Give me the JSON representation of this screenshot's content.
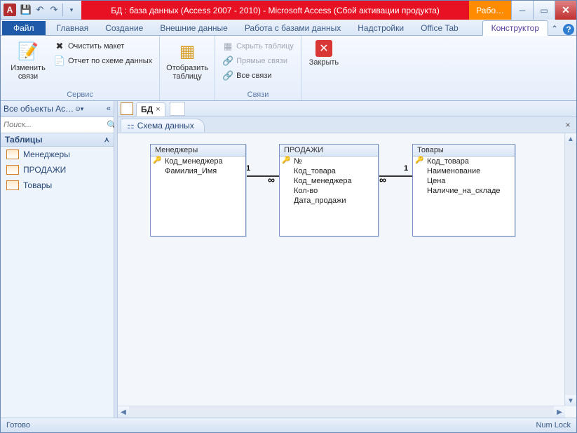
{
  "title": "БД : база данных (Access 2007 - 2010)  -  Microsoft Access (Сбой активации продукта)",
  "contextTab": "Рабо…",
  "tabs": {
    "file": "Файл",
    "items": [
      "Главная",
      "Создание",
      "Внешние данные",
      "Работа с базами данных",
      "Надстройки",
      "Office Tab"
    ],
    "active": "Конструктор"
  },
  "ribbon": {
    "g1": {
      "label": "Сервис",
      "edit": "Изменить\nсвязи",
      "clear": "Очистить макет",
      "report": "Отчет по схеме данных"
    },
    "g2": {
      "label": "",
      "show": "Отобразить\nтаблицу"
    },
    "g3": {
      "label": "Связи",
      "hide": "Скрыть таблицу",
      "direct": "Прямые связи",
      "all": "Все связи"
    },
    "g4": {
      "close": "Закрыть"
    }
  },
  "nav": {
    "header": "Все объекты Ac…",
    "searchPlaceholder": "Поиск...",
    "section": "Таблицы",
    "items": [
      "Менеджеры",
      "ПРОДАЖИ",
      "Товары"
    ]
  },
  "docTab": "БД",
  "schemaTab": "Схема данных",
  "tables": {
    "t1": {
      "title": "Менеджеры",
      "fields": [
        {
          "n": "Код_менеджера",
          "k": true
        },
        {
          "n": "Фамилия_Имя",
          "k": false
        }
      ]
    },
    "t2": {
      "title": "ПРОДАЖИ",
      "fields": [
        {
          "n": "№",
          "k": true
        },
        {
          "n": "Код_товара",
          "k": false
        },
        {
          "n": "Код_менеджера",
          "k": false
        },
        {
          "n": "Кол-во",
          "k": false
        },
        {
          "n": "Дата_продажи",
          "k": false
        }
      ]
    },
    "t3": {
      "title": "Товары",
      "fields": [
        {
          "n": "Код_товара",
          "k": true
        },
        {
          "n": "Наименование",
          "k": false
        },
        {
          "n": "Цена",
          "k": false
        },
        {
          "n": "Наличие_на_складе",
          "k": false
        }
      ]
    }
  },
  "status": {
    "ready": "Готово",
    "numlock": "Num Lock"
  }
}
